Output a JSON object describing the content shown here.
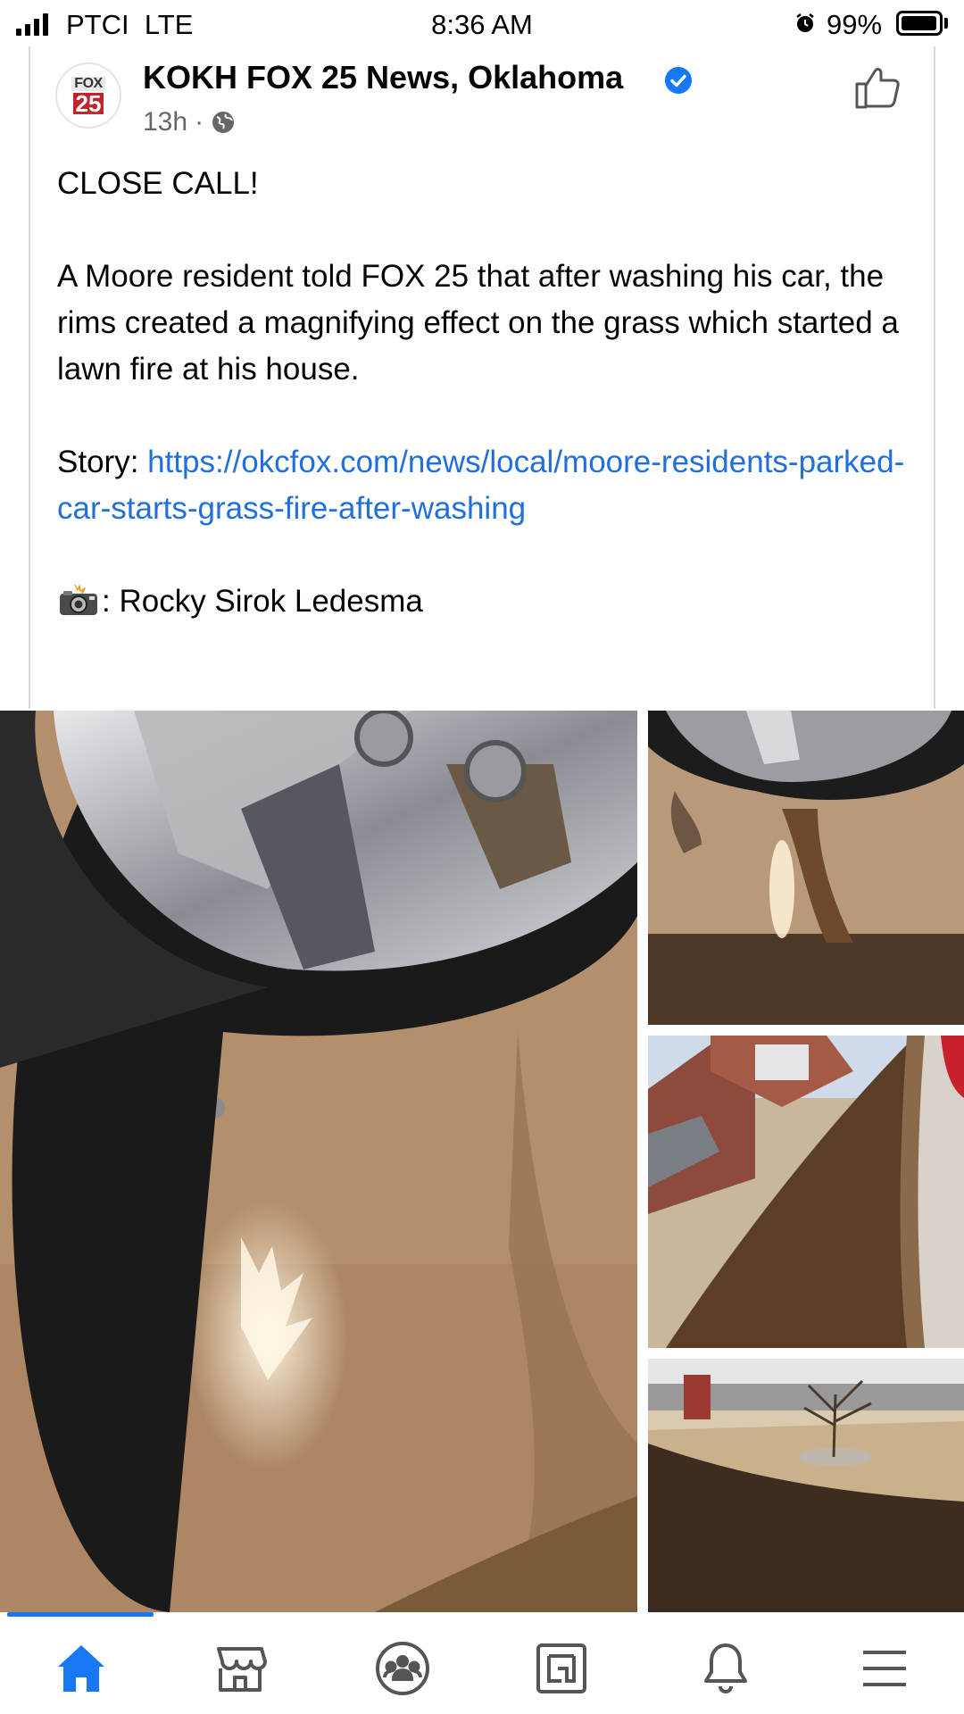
{
  "status_bar": {
    "carrier": "PTCI  LTE",
    "time": "8:36 AM",
    "battery_percent": "99%",
    "battery_level": 0.99,
    "icons": [
      "signal-icon",
      "alarm-icon",
      "battery-icon"
    ]
  },
  "post": {
    "avatar": {
      "line1": "FOX",
      "line2": "25"
    },
    "page_name": "KOKH FOX 25 News, Oklahoma",
    "verified": true,
    "timestamp": "13h",
    "meta_separator": "·",
    "privacy_icon": "globe-icon",
    "action_icon": "like-icon",
    "headline": "CLOSE CALL!",
    "body": "A Moore resident told FOX 25 that after washing his car, the rims created a magnifying effect on the grass which started a lawn fire at his house.",
    "story_label": "Story: ",
    "story_link": "https://okcfox.com/news/local/moore-residents-parked-car-starts-grass-fire-after-washing",
    "photo_credit_icon": "camera-flash-icon",
    "photo_credit": ": Rocky Sirok Ledesma",
    "photos": [
      "wheel-light-reflection-photo",
      "wheel-burned-grass-photo",
      "burned-lawn-house-photo",
      "burned-yard-tree-photo"
    ]
  },
  "bottom_nav": {
    "items": [
      "home-icon",
      "marketplace-icon",
      "groups-icon",
      "gaming-icon",
      "notifications-icon",
      "menu-icon"
    ],
    "active": "home-icon"
  },
  "colors": {
    "accent": "#1877f2",
    "link": "#216fdb",
    "verified": "#1877f2",
    "muted": "#65676b"
  }
}
